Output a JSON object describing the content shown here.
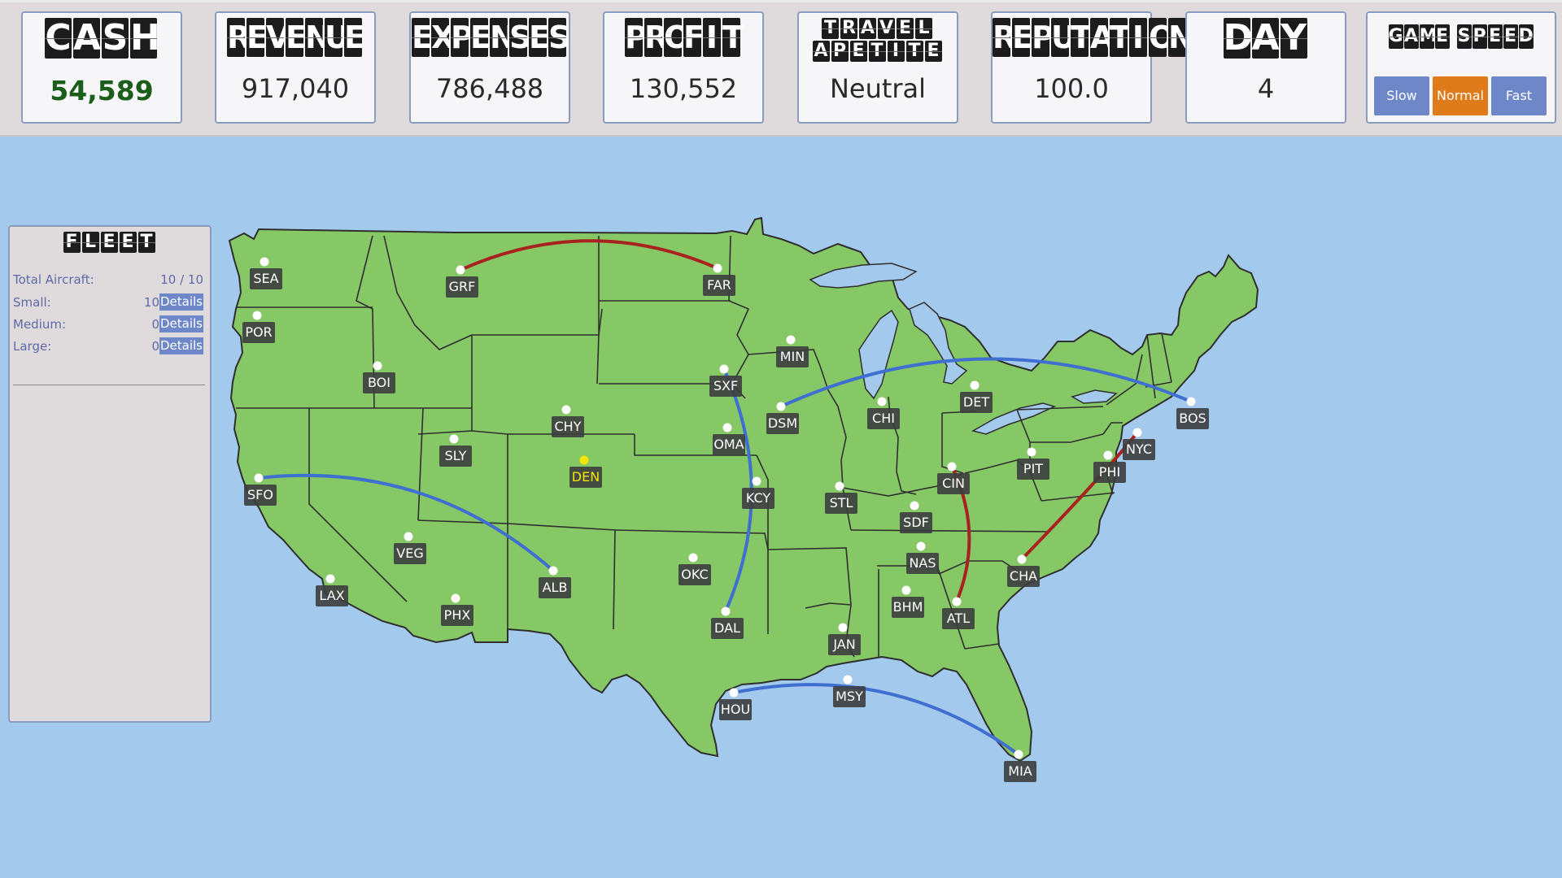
{
  "stats": {
    "cash": {
      "title": "CASH",
      "value": "54,589"
    },
    "revenue": {
      "title": "REVENUE",
      "value": "917,040"
    },
    "expenses": {
      "title": "EXPENSES",
      "value": "786,488"
    },
    "profit": {
      "title": "PROFIT",
      "value": "130,552"
    },
    "travel": {
      "title_line1": "TRAVEL",
      "title_line2": "APETITE",
      "value": "Neutral"
    },
    "reputation": {
      "title": "REPUTATION",
      "value": "100.0"
    },
    "day": {
      "title": "DAY",
      "value": "4"
    }
  },
  "game_speed": {
    "title": "GAME SPEED",
    "options": [
      "Slow",
      "Normal",
      "Fast"
    ],
    "selected": "Normal"
  },
  "colors": {
    "map_land": "#86c766",
    "ocean": "#a3c9ec",
    "route_blue": "#3f6fd1",
    "route_red": "#a8231f",
    "selected_city": "#f2e600",
    "speed_selected": "#df7b1a",
    "speed_default": "#6d87c9"
  },
  "fleet": {
    "title": "FLEET",
    "total_label": "Total Aircraft:",
    "total_value": "10 / 10",
    "rows": [
      {
        "label": "Small:",
        "count": "10",
        "action": "Details"
      },
      {
        "label": "Medium:",
        "count": "0",
        "action": "Details"
      },
      {
        "label": "Large:",
        "count": "0",
        "action": "Details"
      }
    ]
  },
  "cities": [
    "SEA",
    "POR",
    "BOI",
    "GRF",
    "FAR",
    "MIN",
    "SXF",
    "OMA",
    "DSM",
    "CHI",
    "DET",
    "BOS",
    "NYC",
    "PHI",
    "PIT",
    "CIN",
    "SDF",
    "STL",
    "KCY",
    "CHY",
    "DEN",
    "SLY",
    "SFO",
    "LAX",
    "VEG",
    "PHX",
    "ALB",
    "OKC",
    "DAL",
    "HOU",
    "JAN",
    "MSY",
    "NAS",
    "BHM",
    "ATL",
    "CHA",
    "MIA"
  ],
  "selected_city": "DEN",
  "routes": [
    {
      "from": "GRF",
      "to": "FAR",
      "color": "red"
    },
    {
      "from": "SFO",
      "to": "ALB",
      "color": "blue"
    },
    {
      "from": "SXF",
      "to": "DAL",
      "color": "blue"
    },
    {
      "from": "DSM",
      "to": "BOS",
      "color": "blue"
    },
    {
      "from": "CIN",
      "to": "ATL",
      "color": "red"
    },
    {
      "from": "NYC",
      "to": "CHA",
      "color": "red"
    },
    {
      "from": "HOU",
      "to": "MIA",
      "color": "blue"
    }
  ]
}
